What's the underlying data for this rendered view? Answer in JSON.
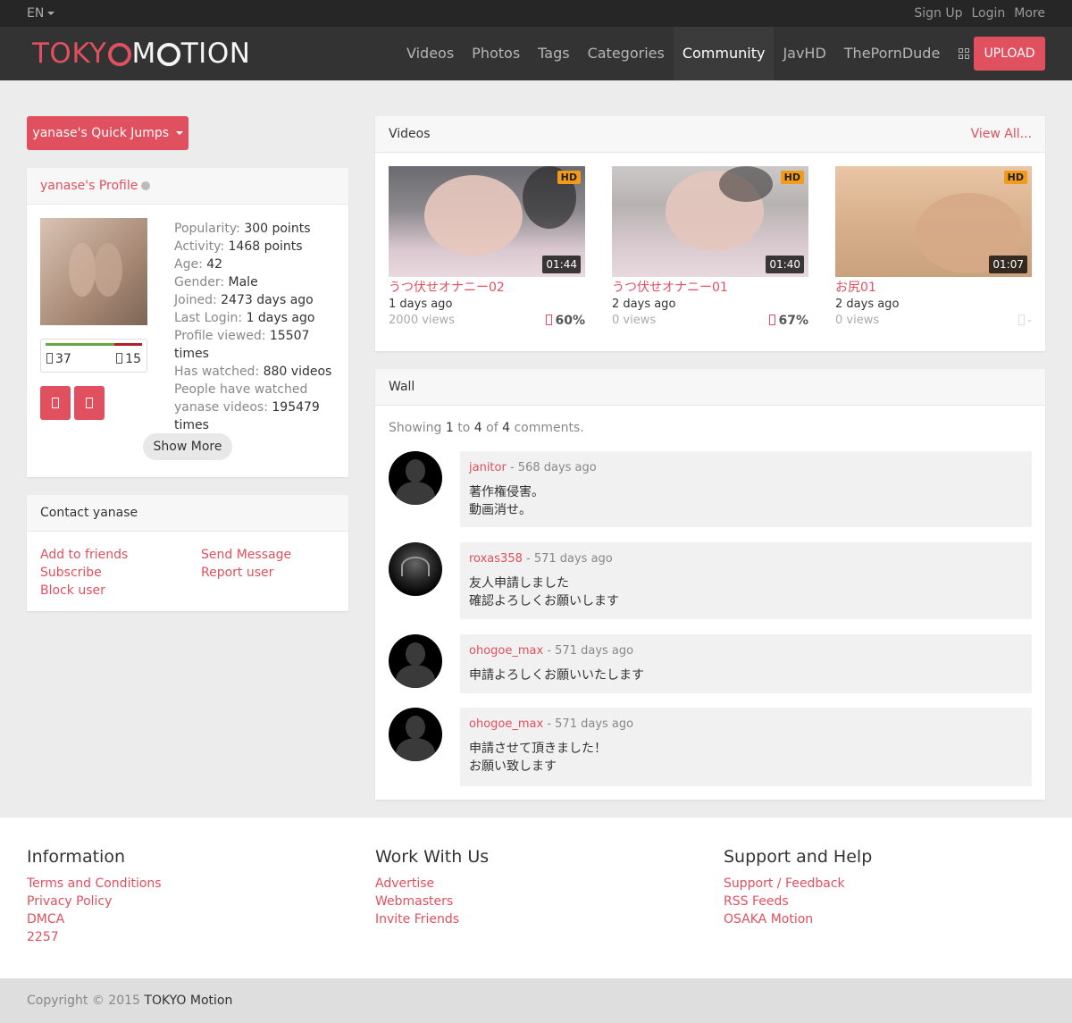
{
  "topbar": {
    "lang": "EN",
    "links": [
      "Sign Up",
      "Login",
      "More"
    ]
  },
  "brand": {
    "part1": "TOKY",
    "part2": "M",
    "part3": "TION"
  },
  "nav": {
    "items": [
      "Videos",
      "Photos",
      "Tags",
      "Categories",
      "Community",
      "JavHD",
      "ThePornDude"
    ],
    "active": "Community",
    "upload": "UPLOAD"
  },
  "colors": {
    "accent": "#e0505e",
    "navbar": "#333333",
    "topbar": "#262626"
  },
  "quick_jumps": "yanase's Quick Jumps",
  "profile": {
    "title": "yanase's Profile",
    "thumbs_up": "37",
    "thumbs_down": "15",
    "stats": [
      {
        "label": "Popularity:",
        "value": "300 points"
      },
      {
        "label": "Activity:",
        "value": "1468 points"
      },
      {
        "label": "Age:",
        "value": "42"
      },
      {
        "label": "Gender:",
        "value": "Male"
      },
      {
        "label": "Joined:",
        "value": "2473 days ago"
      },
      {
        "label": "Last Login:",
        "value": "1 days ago"
      },
      {
        "label": "Profile viewed:",
        "value": "15507 times"
      },
      {
        "label": "Has watched:",
        "value": "880 videos"
      },
      {
        "label": "People have watched yanase videos:",
        "value": "195479 times"
      }
    ],
    "show_more": "Show More"
  },
  "contact": {
    "title": "Contact yanase",
    "links": [
      "Add to friends",
      "Subscribe",
      "Block user",
      "Send Message",
      "Report user"
    ]
  },
  "videos": {
    "title": "Videos",
    "view_all": "View All...",
    "items": [
      {
        "badge": "HD",
        "duration": "01:44",
        "title": "うつ伏せオナニー02",
        "age": "1 days ago",
        "views": "2000 views",
        "rating": "60%"
      },
      {
        "badge": "HD",
        "duration": "01:40",
        "title": "うつ伏せオナニー01",
        "age": "2 days ago",
        "views": "0 views",
        "rating": "67%"
      },
      {
        "badge": "HD",
        "duration": "01:07",
        "title": "お尻01",
        "age": "2 days ago",
        "views": "0 views",
        "rating": "-"
      }
    ]
  },
  "wall": {
    "title": "Wall",
    "showing": {
      "prefix": "Showing",
      "from": "1",
      "to_word": "to",
      "to": "4",
      "of_word": "of",
      "total": "4",
      "suffix": "comments."
    },
    "comments": [
      {
        "user": "janitor",
        "when": "- 568 days ago",
        "lines": [
          "著作権侵害。",
          "動画消せ。"
        ]
      },
      {
        "user": "roxas358",
        "when": "- 571 days ago",
        "lines": [
          "友人申請しました",
          "確認よろしくお願いします"
        ]
      },
      {
        "user": "ohogoe_max",
        "when": "- 571 days ago",
        "lines": [
          "申請よろしくお願いいたします"
        ]
      },
      {
        "user": "ohogoe_max",
        "when": "- 571 days ago",
        "lines": [
          "申請させて頂きました！",
          "お願い致します"
        ]
      }
    ]
  },
  "footer": {
    "columns": [
      {
        "title": "Information",
        "links": [
          "Terms and Conditions",
          "Privacy Policy",
          "DMCA",
          "2257"
        ]
      },
      {
        "title": "Work With Us",
        "links": [
          "Advertise",
          "Webmasters",
          "Invite Friends"
        ]
      },
      {
        "title": "Support and Help",
        "links": [
          "Support / Feedback",
          "RSS Feeds",
          "OSAKA Motion"
        ]
      }
    ],
    "copyright": "Copyright © 2015",
    "copyright_brand": "TOKYO Motion"
  }
}
